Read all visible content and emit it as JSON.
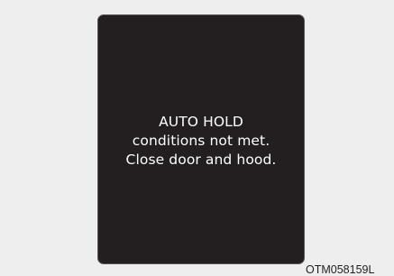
{
  "display": {
    "message_lines": [
      "AUTO HOLD",
      "conditions not met.",
      "Close door and hood."
    ]
  },
  "figure_code": "OTM058159L",
  "colors": {
    "background": "#eeeeee",
    "panel": "#231f20",
    "panel_border": "#5a5657",
    "text": "#ffffff"
  }
}
